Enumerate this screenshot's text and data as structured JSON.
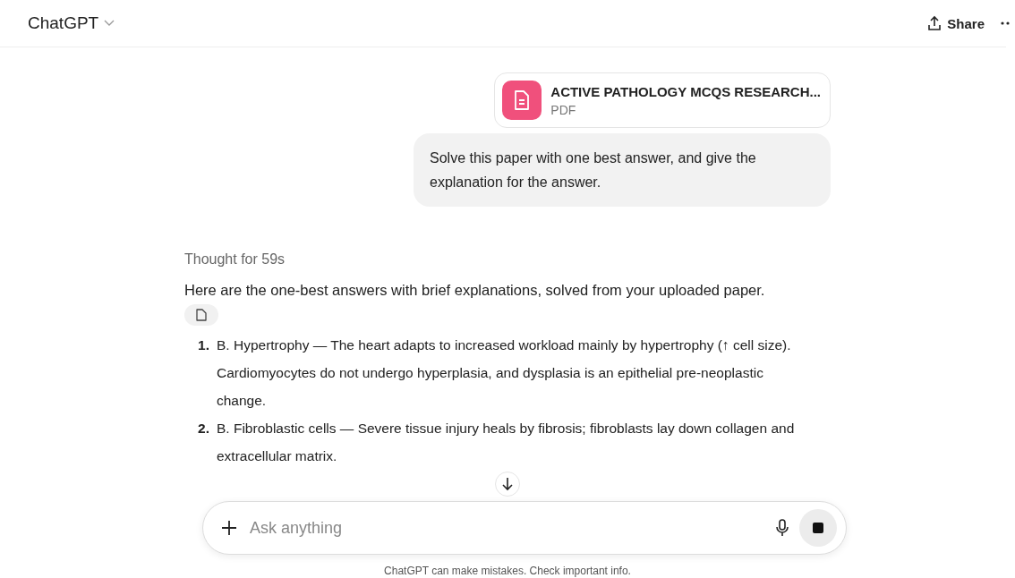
{
  "header": {
    "title": "ChatGPT",
    "share": "Share"
  },
  "attachment": {
    "name": "ACTIVE PATHOLOGY MCQS RESEARCH...",
    "type": "PDF"
  },
  "user_message": "Solve this paper with one best answer, and give the explanation for the answer.",
  "reply": {
    "thought": "Thought for 59s",
    "intro": "Here are the one-best answers with brief explanations, solved from your uploaded paper.",
    "answers": [
      {
        "number": "1.",
        "text": "B. Hypertrophy — The heart adapts to increased workload mainly by hypertrophy (↑ cell size). Cardiomyocytes do not undergo hyperplasia, and dysplasia is an epithelial pre-neoplastic change."
      },
      {
        "number": "2.",
        "text": "B. Fibroblastic cells — Severe tissue injury heals by fibrosis; fibroblasts lay down collagen and extracellular matrix."
      }
    ]
  },
  "composer": {
    "placeholder": "Ask anything"
  },
  "footer": "ChatGPT can make mistakes. Check important info."
}
